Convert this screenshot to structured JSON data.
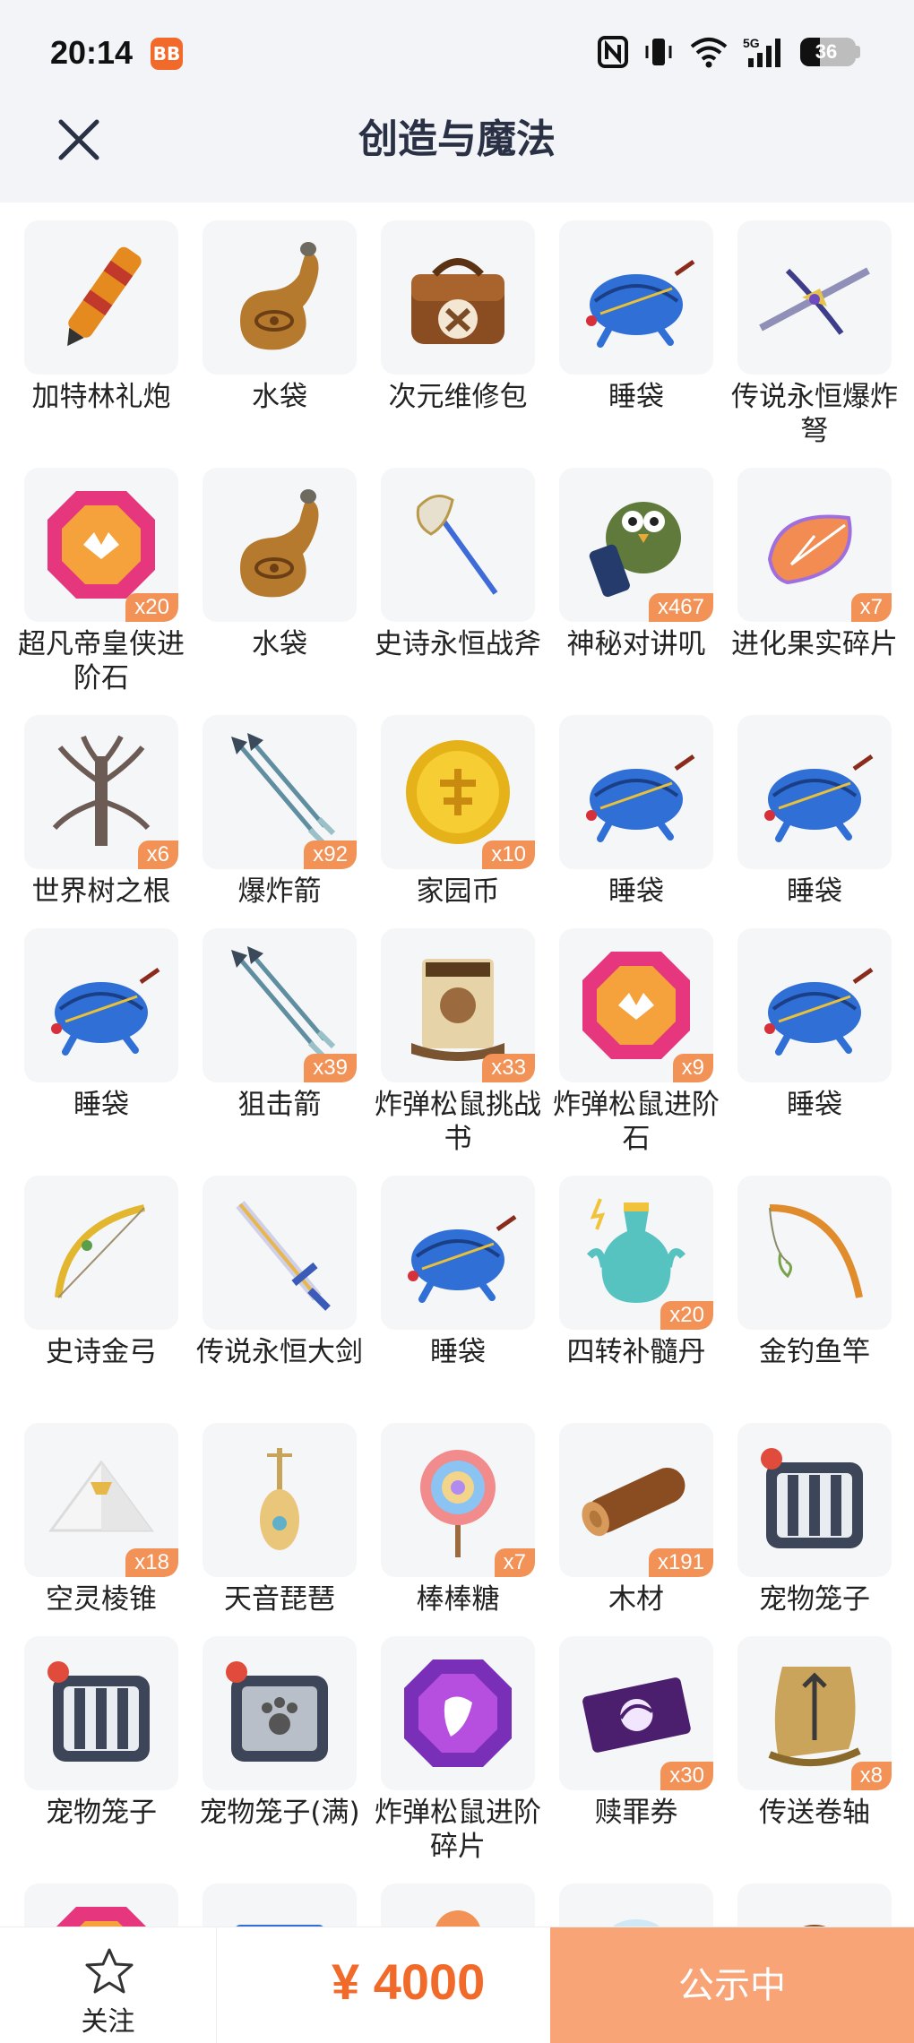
{
  "status_bar": {
    "time": "20:14",
    "app_icon_text": "BB",
    "battery_level": "36",
    "signal_label": "5G"
  },
  "header": {
    "title": "创造与魔法"
  },
  "items": [
    {
      "name": "加特林礼炮",
      "count": "",
      "icon": "cannon-icon"
    },
    {
      "name": "水袋",
      "count": "",
      "icon": "water-bag-icon"
    },
    {
      "name": "次元维修包",
      "count": "",
      "icon": "repair-bag-icon"
    },
    {
      "name": "睡袋",
      "count": "",
      "icon": "sleeping-bag-icon"
    },
    {
      "name": "传说永恒爆炸弩",
      "count": "",
      "icon": "crossbow-icon"
    },
    {
      "name": "超凡帝皇侠进阶石",
      "count": "x20",
      "icon": "gem-icon"
    },
    {
      "name": "水袋",
      "count": "",
      "icon": "water-bag-icon"
    },
    {
      "name": "史诗永恒战斧",
      "count": "",
      "icon": "axe-icon"
    },
    {
      "name": "神秘对讲叽",
      "count": "x467",
      "icon": "walkie-talkie-icon"
    },
    {
      "name": "进化果实碎片",
      "count": "x7",
      "icon": "fruit-fragment-icon"
    },
    {
      "name": "世界树之根",
      "count": "x6",
      "icon": "tree-root-icon"
    },
    {
      "name": "爆炸箭",
      "count": "x92",
      "icon": "arrows-icon"
    },
    {
      "name": "家园币",
      "count": "x10",
      "icon": "coin-icon"
    },
    {
      "name": "睡袋",
      "count": "",
      "icon": "sleeping-bag-icon"
    },
    {
      "name": "睡袋",
      "count": "",
      "icon": "sleeping-bag-icon"
    },
    {
      "name": "睡袋",
      "count": "",
      "icon": "sleeping-bag-icon"
    },
    {
      "name": "狙击箭",
      "count": "x39",
      "icon": "arrows-icon"
    },
    {
      "name": "炸弹松鼠挑战书",
      "count": "x33",
      "icon": "wanted-scroll-icon"
    },
    {
      "name": "炸弹松鼠进阶石",
      "count": "x9",
      "icon": "gem-icon"
    },
    {
      "name": "睡袋",
      "count": "",
      "icon": "sleeping-bag-icon"
    },
    {
      "name": "史诗金弓",
      "count": "",
      "icon": "bow-icon"
    },
    {
      "name": "传说永恒大剑",
      "count": "",
      "icon": "sword-icon"
    },
    {
      "name": "睡袋",
      "count": "",
      "icon": "sleeping-bag-icon"
    },
    {
      "name": "四转补髓丹",
      "count": "x20",
      "icon": "potion-icon"
    },
    {
      "name": "金钓鱼竿",
      "count": "",
      "icon": "fishing-rod-icon"
    },
    {
      "name": "空灵棱锥",
      "count": "x18",
      "icon": "pyramid-icon"
    },
    {
      "name": "天音琵琶",
      "count": "",
      "icon": "lute-icon"
    },
    {
      "name": "棒棒糖",
      "count": "x7",
      "icon": "lollipop-icon"
    },
    {
      "name": "木材",
      "count": "x191",
      "icon": "wood-icon"
    },
    {
      "name": "宠物笼子",
      "count": "",
      "icon": "pet-cage-icon"
    },
    {
      "name": "宠物笼子",
      "count": "",
      "icon": "pet-cage-icon"
    },
    {
      "name": "宠物笼子(满)",
      "count": "",
      "icon": "pet-cage-full-icon"
    },
    {
      "name": "炸弹松鼠进阶碎片",
      "count": "",
      "icon": "purple-gem-icon"
    },
    {
      "name": "赎罪券",
      "count": "x30",
      "icon": "ticket-icon"
    },
    {
      "name": "传送卷轴",
      "count": "x8",
      "icon": "teleport-scroll-icon"
    },
    {
      "name": "",
      "count": "",
      "icon": "gem-icon"
    },
    {
      "name": "",
      "count": "",
      "icon": "box-icon"
    },
    {
      "name": "",
      "count": "",
      "icon": "orb-icon"
    },
    {
      "name": "",
      "count": "",
      "icon": "crystal-icon"
    },
    {
      "name": "",
      "count": "",
      "icon": "saddle-icon"
    }
  ],
  "bottom_bar": {
    "follow_label": "关注",
    "price": "¥ 4000",
    "status_label": "公示中"
  },
  "colors": {
    "accent": "#f26a2a",
    "badge": "#f29257",
    "status_button": "#f9a477",
    "header_bg": "#f2f4f8",
    "title": "#2a3144"
  }
}
